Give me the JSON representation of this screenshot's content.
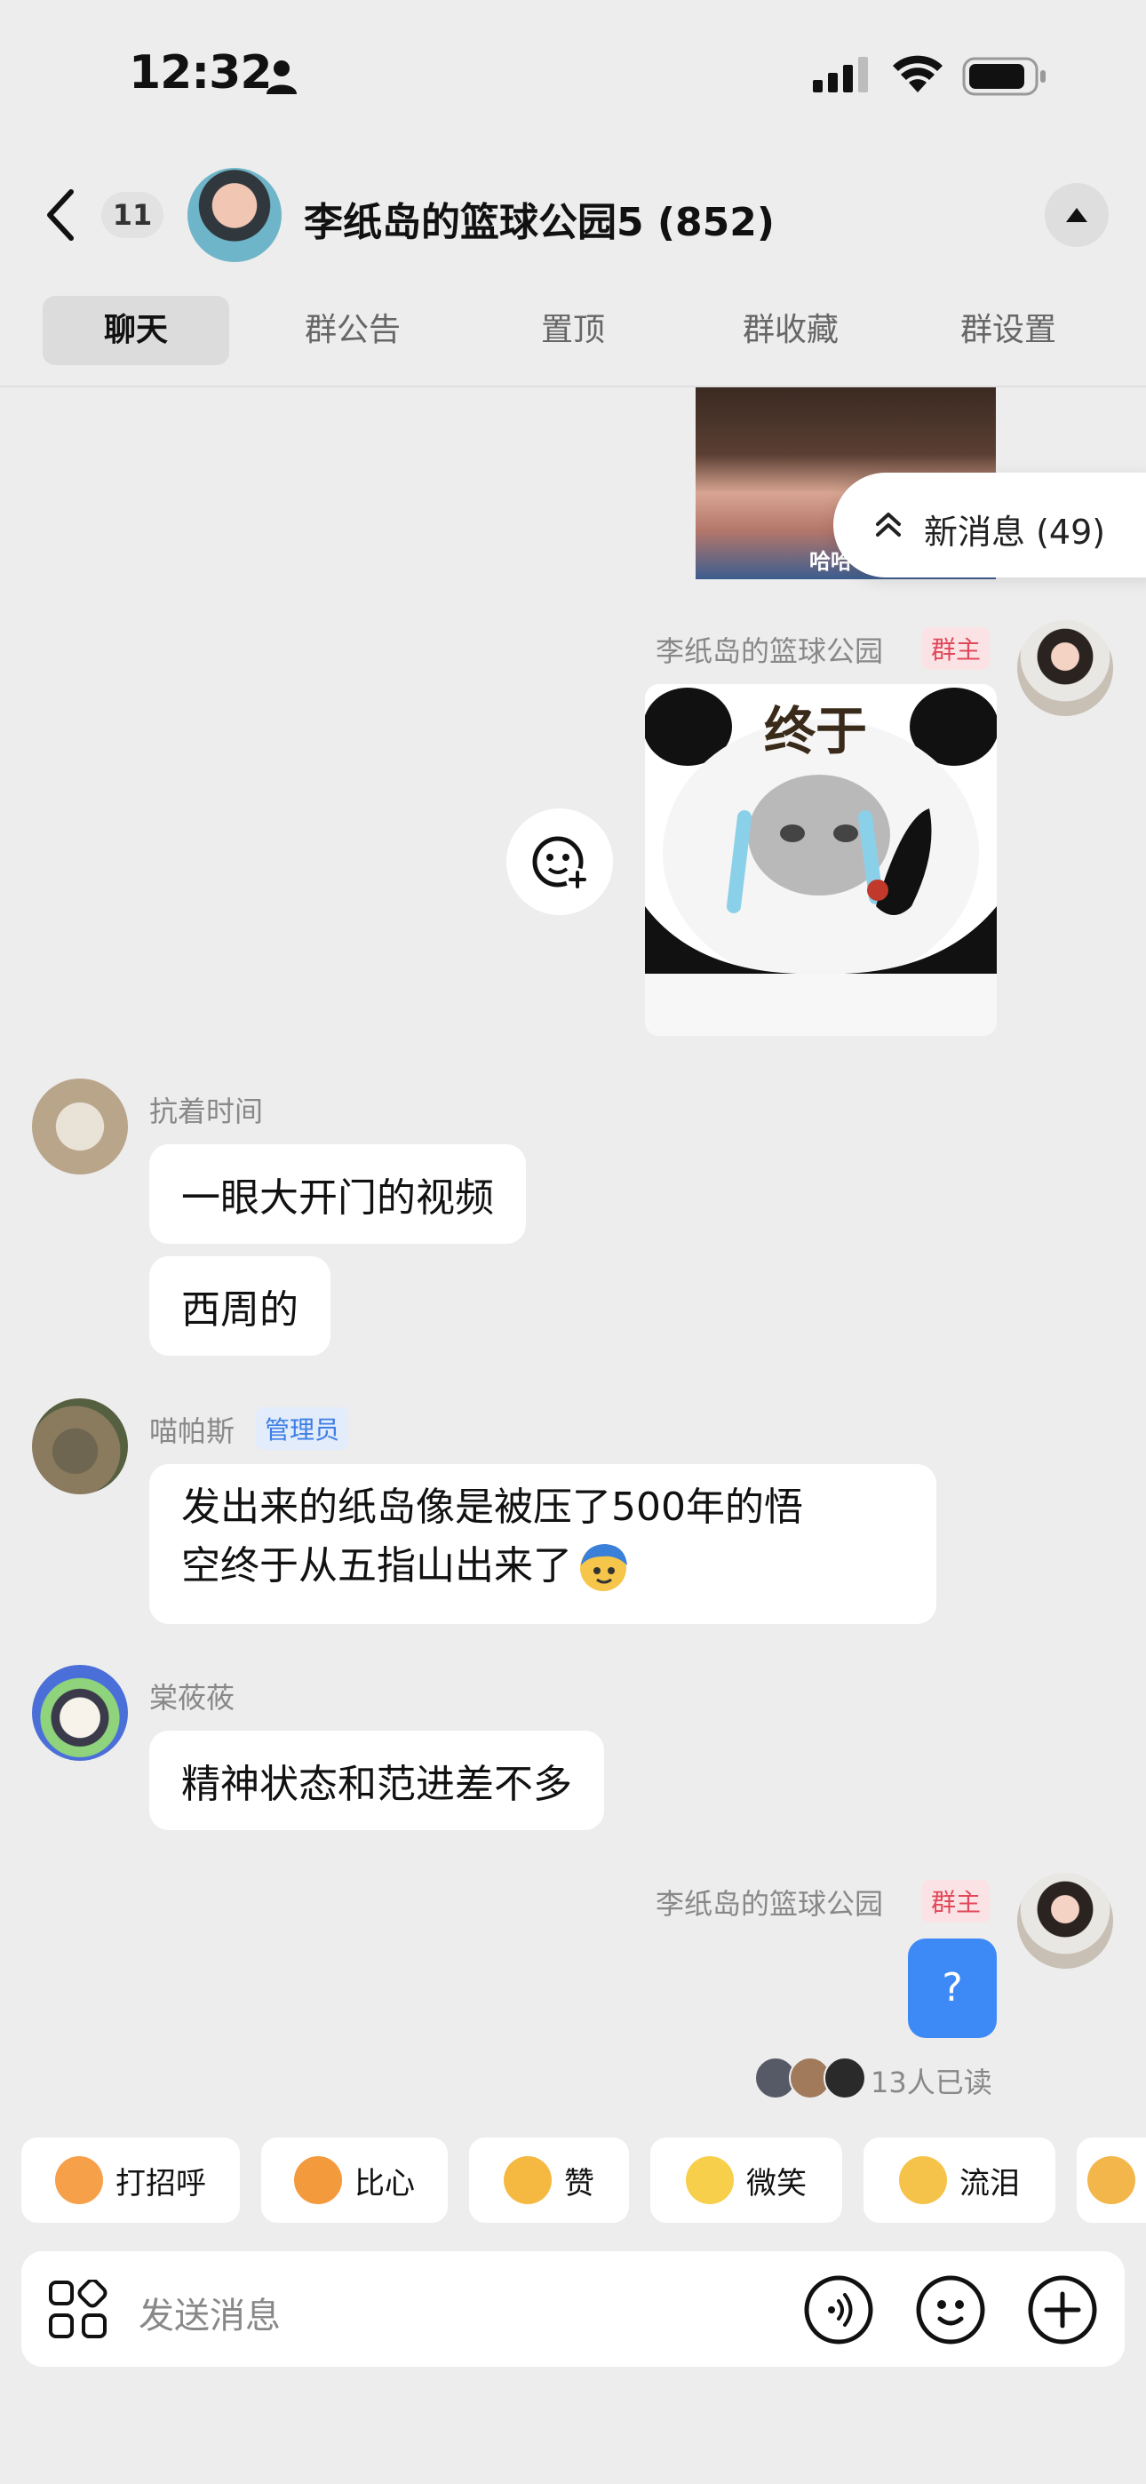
{
  "status_bar": {
    "time": "12:32"
  },
  "header": {
    "unread_count": "11",
    "title": "李纸岛的篮球公园5 (852)"
  },
  "tabs": [
    {
      "label": "聊天"
    },
    {
      "label": "群公告"
    },
    {
      "label": "置顶"
    },
    {
      "label": "群收藏"
    },
    {
      "label": "群设置"
    }
  ],
  "top_photo": {
    "caption": "哈哈"
  },
  "new_messages": {
    "label": "新消息 (49)"
  },
  "messages": [
    {
      "sender": "李纸岛的篮球公园",
      "badge": "群主",
      "sticker_text": "终于"
    },
    {
      "sender": "抗着时间",
      "bubbles": [
        "一眼大开门的视频",
        "西周的"
      ]
    },
    {
      "sender": "喵帕斯",
      "badge": "管理员",
      "bubble_line1": "发出来的纸岛像是被压了500年的悟",
      "bubble_line2": "空终于从五指山出来了"
    },
    {
      "sender": "棠莜莜",
      "bubbles": [
        "精神状态和范进差不多"
      ]
    },
    {
      "sender": "李纸岛的篮球公园",
      "badge": "群主",
      "bubble": "?"
    }
  ],
  "read_receipt": "13人已读",
  "quick_replies": [
    {
      "label": "打招呼",
      "color": "#f6a04a"
    },
    {
      "label": "比心",
      "color": "#f39a3d"
    },
    {
      "label": "赞",
      "color": "#f5b942"
    },
    {
      "label": "微笑",
      "color": "#f7cf4a"
    },
    {
      "label": "流泪",
      "color": "#f6c34a"
    }
  ],
  "input": {
    "placeholder": "发送消息"
  },
  "colors": {
    "accent_blue": "#3d8af6",
    "owner_badge": "#e0485a",
    "admin_badge": "#3d7ee6"
  }
}
